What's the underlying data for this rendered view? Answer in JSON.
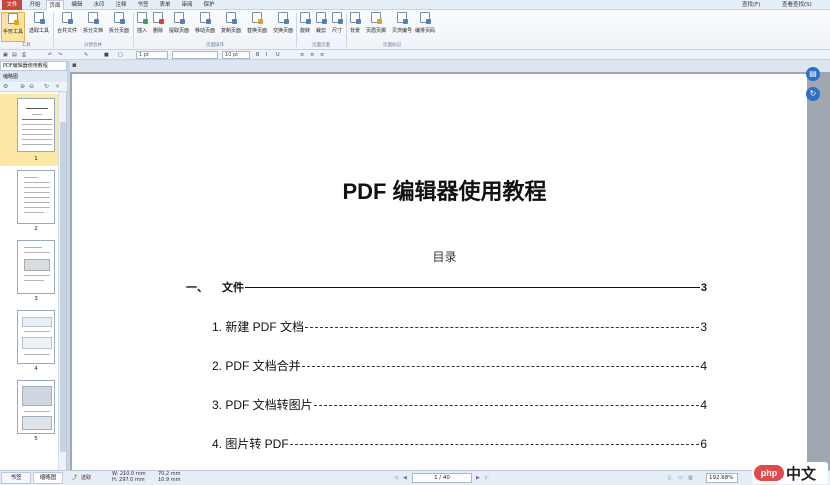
{
  "menubar": {
    "tabs": [
      "文件",
      "开始",
      "页面",
      "编辑",
      "水印",
      "注释",
      "书签",
      "表单",
      "审阅",
      "保护"
    ],
    "active_tab": "页面",
    "right": [
      "查找(F)",
      "查看查找(S)"
    ]
  },
  "ribbon": {
    "buttons": [
      "手形工具",
      "选取工具",
      "合并文件",
      "拆分文档",
      "拆分页面",
      "插入",
      "删除",
      "提取页面",
      "移动页面",
      "复制页面",
      "替换页面",
      "交换页面",
      "旋转",
      "裁剪",
      "尺寸",
      "背景",
      "页眉页脚",
      "贝茨编号",
      "编排页码"
    ],
    "groups": [
      "工具",
      "分割合并",
      "页面操作",
      "页面页面",
      "页面标记"
    ]
  },
  "format_bar": {
    "line_width": "1 pt",
    "font_size": "10 pt"
  },
  "left_panel": {
    "doc_tab": "PDF编辑器使用教程",
    "header": "缩略图",
    "pages": [
      "1",
      "2",
      "3",
      "4",
      "5"
    ]
  },
  "document": {
    "title": "PDF 编辑器使用教程",
    "toc_heading": "目录",
    "toc": [
      {
        "num": "一、",
        "text": "文件",
        "page": "3"
      },
      {
        "num": "",
        "text": "1. 新建 PDF 文档",
        "page": "3"
      },
      {
        "num": "",
        "text": "2. PDF 文档合并",
        "page": "4"
      },
      {
        "num": "",
        "text": "3. PDF 文档转图片",
        "page": "4"
      },
      {
        "num": "",
        "text": "4. 图片转 PDF",
        "page": "6"
      }
    ]
  },
  "status": {
    "tabs": [
      "书签",
      "缩略图"
    ],
    "select_mode": "选取",
    "width": "W: 210.0 mm",
    "height": "H: 297.0 mm",
    "x": "70.2 mm",
    "y": "10.9 mm",
    "page_indicator": "1 / 40",
    "zoom": "192.68%"
  },
  "watermark": {
    "logo": "php",
    "text": "中文网"
  },
  "colors": {
    "accent": "#2e6fc8",
    "file_tab": "#c8473b",
    "selected": "#fde9a6"
  }
}
